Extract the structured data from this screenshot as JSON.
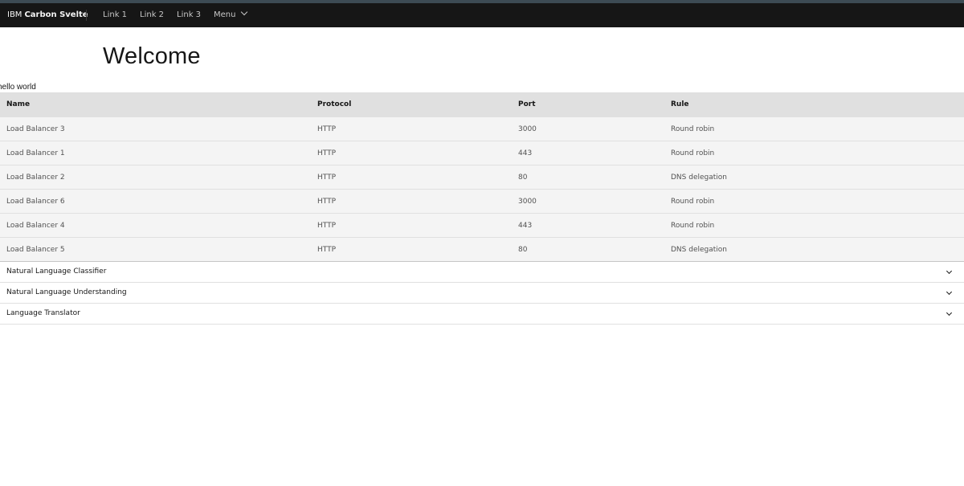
{
  "header": {
    "brand_prefix": "IBM",
    "brand_name": "Carbon Svelte",
    "links": [
      "Link 1",
      "Link 2",
      "Link 3"
    ],
    "menu_label": "Menu"
  },
  "main": {
    "title": "Welcome",
    "hello_text": "hello world"
  },
  "table": {
    "headers": {
      "name": "Name",
      "protocol": "Protocol",
      "port": "Port",
      "rule": "Rule"
    },
    "rows": [
      {
        "name": "Load Balancer 3",
        "protocol": "HTTP",
        "port": "3000",
        "rule": "Round robin"
      },
      {
        "name": "Load Balancer 1",
        "protocol": "HTTP",
        "port": "443",
        "rule": "Round robin"
      },
      {
        "name": "Load Balancer 2",
        "protocol": "HTTP",
        "port": "80",
        "rule": "DNS delegation"
      },
      {
        "name": "Load Balancer 6",
        "protocol": "HTTP",
        "port": "3000",
        "rule": "Round robin"
      },
      {
        "name": "Load Balancer 4",
        "protocol": "HTTP",
        "port": "443",
        "rule": "Round robin"
      },
      {
        "name": "Load Balancer 5",
        "protocol": "HTTP",
        "port": "80",
        "rule": "DNS delegation"
      }
    ]
  },
  "accordion": {
    "items": [
      {
        "title": "Natural Language Classifier"
      },
      {
        "title": "Natural Language Understanding"
      },
      {
        "title": "Language Translator"
      }
    ]
  },
  "colors": {
    "header_bg": "#161616",
    "top_strip": "#3d4b54",
    "table_header_bg": "#e0e0e0",
    "table_row_bg": "#f4f4f4"
  },
  "icons": {
    "menu_chevron": "chevron-down-icon",
    "accordion_chevron": "chevron-down-icon"
  }
}
